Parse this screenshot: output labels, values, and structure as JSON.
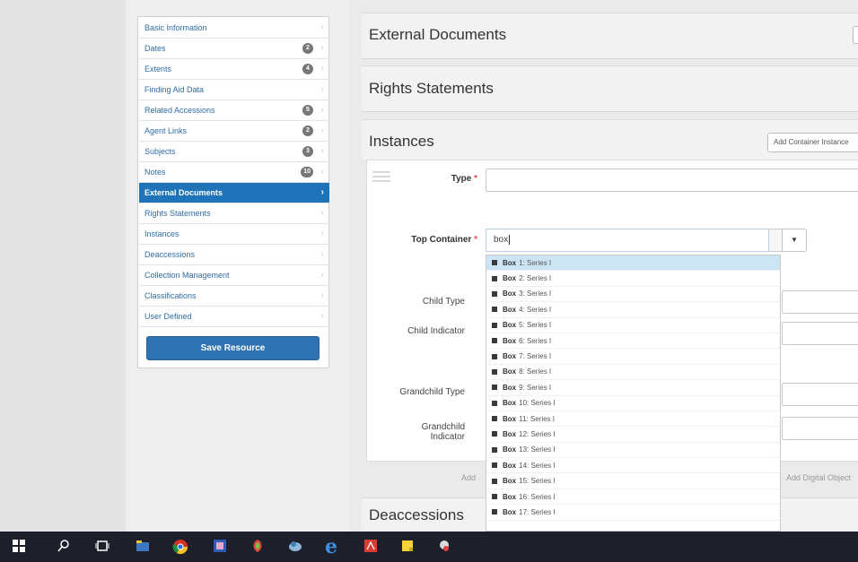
{
  "sidebar": {
    "items": [
      {
        "label": "Basic Information"
      },
      {
        "label": "Dates",
        "badge": "2"
      },
      {
        "label": "Extents",
        "badge": "4"
      },
      {
        "label": "Finding Aid Data"
      },
      {
        "label": "Related Accessions",
        "badge": "5"
      },
      {
        "label": "Agent Links",
        "badge": "2"
      },
      {
        "label": "Subjects",
        "badge": "3"
      },
      {
        "label": "Notes",
        "badge": "10"
      },
      {
        "label": "External Documents",
        "active": true
      },
      {
        "label": "Rights Statements"
      },
      {
        "label": "Instances"
      },
      {
        "label": "Deaccessions"
      },
      {
        "label": "Collection Management"
      },
      {
        "label": "Classifications"
      },
      {
        "label": "User Defined"
      }
    ],
    "save_label": "Save Resource"
  },
  "sections": {
    "external_documents": "External Documents",
    "rights_statements": "Rights Statements",
    "instances": "Instances",
    "deaccessions": "Deaccessions"
  },
  "instances": {
    "add_container_label": "Add Container Instance",
    "type_label": "Type",
    "top_container_label": "Top Container",
    "top_container_value": "box",
    "child_type_label": "Child Type",
    "child_indicator_label": "Child Indicator",
    "grandchild_type_label": "Grandchild Type",
    "grandchild_indicator_label": "Grandchild Indicator",
    "add_left_label": "Add",
    "add_digital_label": "Add Digital Object"
  },
  "dropdown": {
    "items": [
      {
        "bold": "Box",
        "rest": "1: Series I"
      },
      {
        "bold": "Box",
        "rest": "2: Series I"
      },
      {
        "bold": "Box",
        "rest": "3: Series I"
      },
      {
        "bold": "Box",
        "rest": "4: Series I"
      },
      {
        "bold": "Box",
        "rest": "5: Series I"
      },
      {
        "bold": "Box",
        "rest": "6: Series I"
      },
      {
        "bold": "Box",
        "rest": "7: Series I"
      },
      {
        "bold": "Box",
        "rest": "8: Series I"
      },
      {
        "bold": "Box",
        "rest": "9: Series I"
      },
      {
        "bold": "Box",
        "rest": "10: Series I"
      },
      {
        "bold": "Box",
        "rest": "11: Series I"
      },
      {
        "bold": "Box",
        "rest": "12: Series I"
      },
      {
        "bold": "Box",
        "rest": "13: Series I"
      },
      {
        "bold": "Box",
        "rest": "14: Series I"
      },
      {
        "bold": "Box",
        "rest": "15: Series I"
      },
      {
        "bold": "Box",
        "rest": "16: Series I"
      },
      {
        "bold": "Box",
        "rest": "17: Series I"
      }
    ],
    "highlighted_index": 0
  },
  "taskbar": {
    "icons": [
      "windows-start-icon",
      "search-icon",
      "task-view-icon",
      "file-explorer-icon",
      "chrome-icon",
      "app-icon",
      "app-icon-2",
      "app-icon-3",
      "edge-icon",
      "pdf-icon",
      "sticky-notes-icon",
      "app-icon-4"
    ]
  },
  "colors": {
    "accent": "#1f74b9",
    "save_button": "#2f73b2",
    "required": "#d9534f",
    "highlight": "#cde4f5",
    "taskbar": "#1d1f2b"
  }
}
